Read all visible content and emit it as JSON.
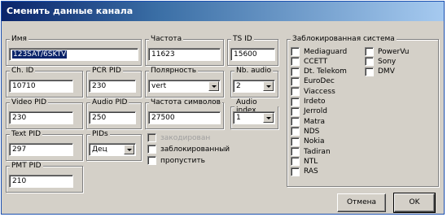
{
  "window": {
    "title": "Сменить данные канала"
  },
  "fields": {
    "name": {
      "label": "Имя",
      "value": "123SAT/6SKTV"
    },
    "freq": {
      "label": "Частота",
      "value": "11623"
    },
    "tsid": {
      "label": "TS ID",
      "value": "15600"
    },
    "chid": {
      "label": "Ch. ID",
      "value": "10710"
    },
    "pcrpid": {
      "label": "PCR PID",
      "value": "230"
    },
    "polarity": {
      "label": "Полярность",
      "value": "vert"
    },
    "nbaudio": {
      "label": "Nb. audio",
      "value": "2"
    },
    "videopid": {
      "label": "Video PID",
      "value": "230"
    },
    "audiopid": {
      "label": "Audio PID",
      "value": "250"
    },
    "symrate": {
      "label": "Частота символов",
      "value": "27500"
    },
    "audioindex": {
      "label": "Audio index",
      "value": "1"
    },
    "textpid": {
      "label": "Text PID",
      "value": "297"
    },
    "pids": {
      "label": "PIDs",
      "value": "Дец"
    },
    "pmtpid": {
      "label": "PMT PID",
      "value": "210"
    }
  },
  "flags": [
    {
      "label": "закодирован",
      "checked": false,
      "disabled": true
    },
    {
      "label": "заблокированный",
      "checked": false,
      "disabled": false
    },
    {
      "label": "пропустить",
      "checked": false,
      "disabled": false
    }
  ],
  "systems": {
    "legend": "Заблокированная система",
    "col1": [
      "Mediaguard",
      "CCETT",
      "Dt. Telekom",
      "EuroDec",
      "Viaccess",
      "Irdeto",
      "Jerrold",
      "Matra",
      "NDS",
      "Nokia",
      "Tadiran",
      "NTL",
      "RAS"
    ],
    "col2": [
      "PowerVu",
      "Sony",
      "DMV"
    ]
  },
  "buttons": {
    "cancel": "Отмена",
    "ok": "OK"
  }
}
